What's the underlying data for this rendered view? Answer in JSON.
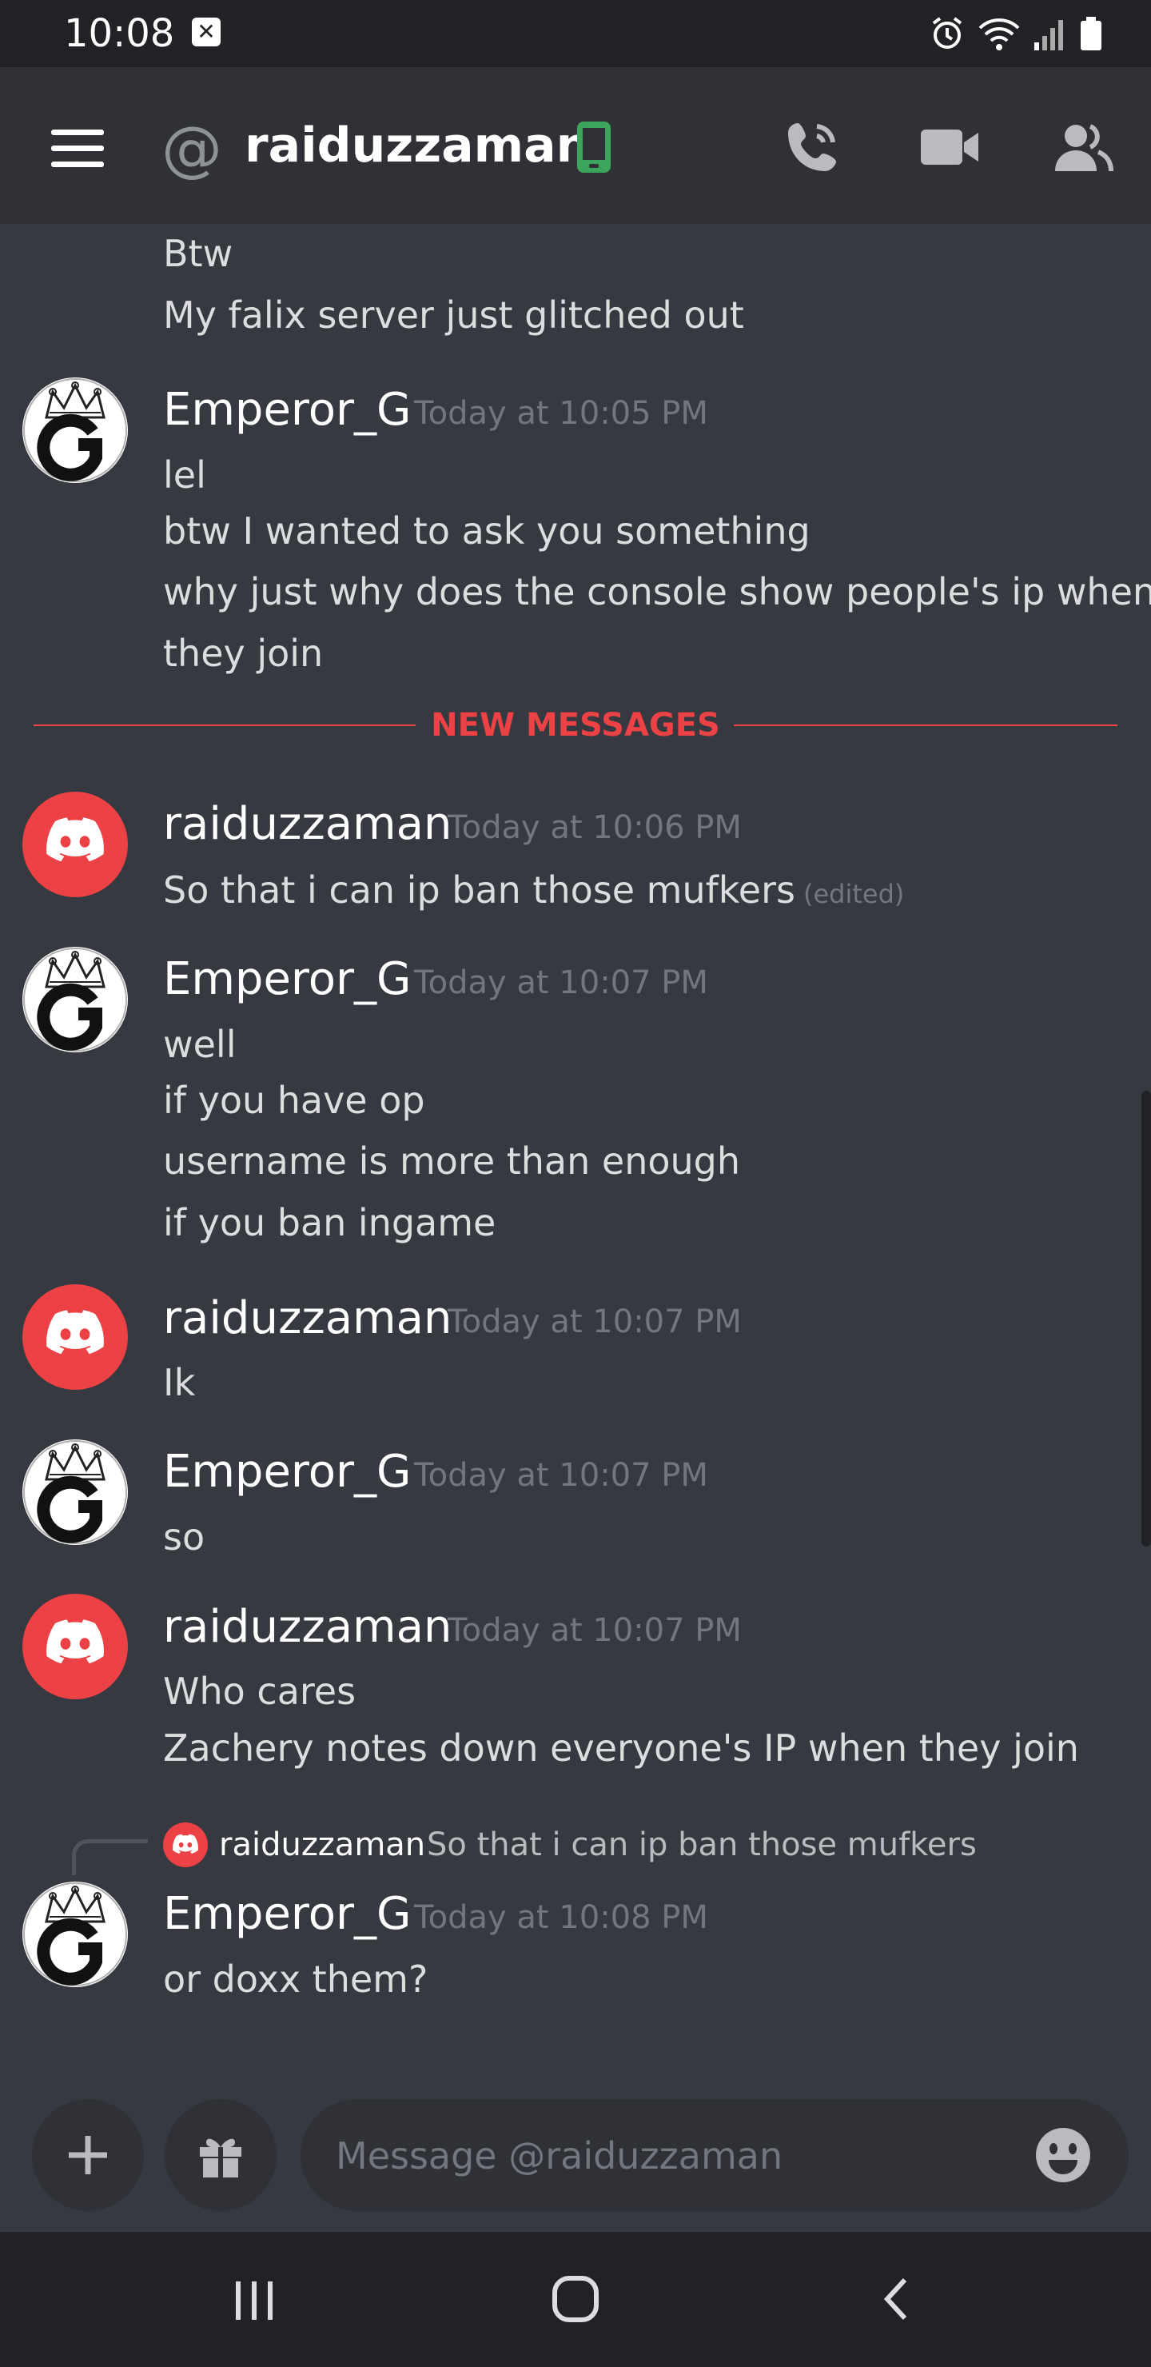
{
  "status_bar": {
    "time": "10:08",
    "icons": [
      "notification-icon",
      "alarm-icon",
      "wifi-icon",
      "signal-icon",
      "battery-icon"
    ]
  },
  "header": {
    "at_symbol": "@",
    "title": "raiduzzaman",
    "status": "mobile-online",
    "icons": [
      "menu-icon",
      "at-icon",
      "mobile-status-icon",
      "voice-call-icon",
      "video-call-icon",
      "member-list-icon"
    ],
    "colors": {
      "mobile_status": "#3ba55c"
    }
  },
  "messages": {
    "continued": {
      "lines": [
        "Btw",
        "My falix server just glitched out"
      ]
    },
    "groups": [
      {
        "author": "Emperor_G",
        "timestamp": "Today at 10:05 PM",
        "lines": [
          "lel",
          "btw I wanted to ask you something",
          "why just why does the console show people's ip when",
          "they join"
        ]
      },
      {
        "author": "raiduzzaman",
        "timestamp": "Today at 10:06 PM",
        "lines": [
          "So that i can ip ban those mufkers"
        ],
        "edited_label": "(edited)"
      },
      {
        "author": "Emperor_G",
        "timestamp": "Today at 10:07 PM",
        "lines": [
          "well",
          "if you have op",
          "username is more than enough",
          "if you ban ingame"
        ]
      },
      {
        "author": "raiduzzaman",
        "timestamp": "Today at 10:07 PM",
        "lines": [
          "Ik"
        ]
      },
      {
        "author": "Emperor_G",
        "timestamp": "Today at 10:07 PM",
        "lines": [
          "so"
        ]
      },
      {
        "author": "raiduzzaman",
        "timestamp": "Today at 10:07 PM",
        "lines": [
          "Who cares",
          "Zachery notes down everyone's IP when they join"
        ]
      },
      {
        "author": "Emperor_G",
        "timestamp": "Today at 10:08 PM",
        "lines": [
          "or doxx them?"
        ],
        "reply": {
          "author": "raiduzzaman",
          "text": "So that i can ip ban those mufkers"
        }
      }
    ],
    "new_messages_label": "NEW MESSAGES"
  },
  "composer": {
    "placeholder": "Message @raiduzzaman",
    "icons": [
      "add-icon",
      "gift-icon",
      "emoji-icon"
    ]
  },
  "nav_bar": {
    "icons": [
      "recent-apps-icon",
      "home-icon",
      "back-icon"
    ]
  },
  "colors": {
    "background": "#36393f",
    "header": "#2f3136",
    "system_bar": "#202225",
    "accent_red": "#ed4245",
    "text": "#dcddde",
    "muted": "#72767d"
  }
}
